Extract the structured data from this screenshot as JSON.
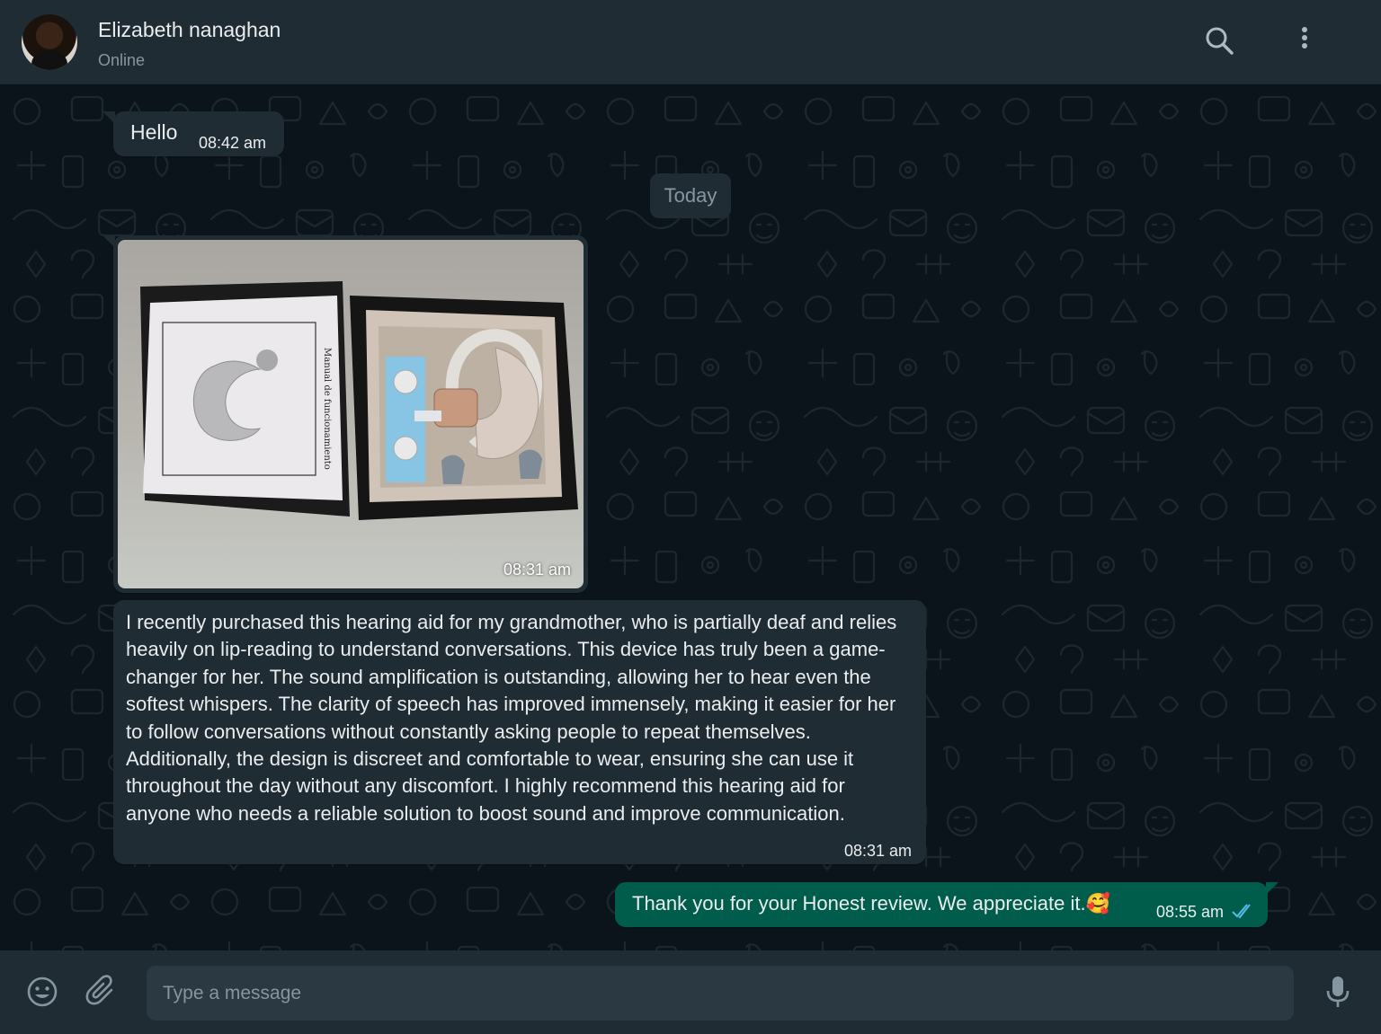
{
  "header": {
    "contact_name": "Elizabeth nanaghan",
    "status": "Online",
    "icons": [
      "search-icon",
      "menu-icon"
    ]
  },
  "chat": {
    "date_divider": "Today",
    "messages": [
      {
        "direction": "incoming",
        "type": "text",
        "text": "Hello",
        "time": "08:42 am"
      },
      {
        "direction": "incoming",
        "type": "image",
        "time": "08:31 am",
        "image_caption_on_photo": "Manual de funcionamiento"
      },
      {
        "direction": "incoming",
        "type": "text",
        "text": " I recently purchased this hearing aid for my grandmother, who is partially deaf and relies heavily on lip-reading to understand conversations. This device has truly been a game-changer for her. The sound amplification is outstanding, allowing her to hear even the softest whispers. The clarity of speech has improved immensely, making it easier for her to follow conversations without constantly asking people to repeat themselves. Additionally, the design is discreet and comfortable to wear, ensuring she can use it throughout the day without any discomfort. I highly recommend this hearing aid for anyone who needs a reliable solution to boost sound and improve communication.",
        "time": "08:31 am"
      },
      {
        "direction": "outgoing",
        "type": "text",
        "text": "Thank you for your Honest review. We appreciate it.🥰",
        "time": "08:55 am",
        "status": "read"
      }
    ]
  },
  "composer": {
    "placeholder": "Type a message",
    "value": "",
    "icons": [
      "emoji-icon",
      "attach-icon",
      "mic-icon"
    ]
  },
  "colors": {
    "header_bg": "#202c33",
    "chat_bg": "#0b141a",
    "incoming_bubble": "#202c33",
    "outgoing_bubble": "#005c4b",
    "read_ticks": "#53bdeb",
    "secondary_text": "#8696a0"
  }
}
